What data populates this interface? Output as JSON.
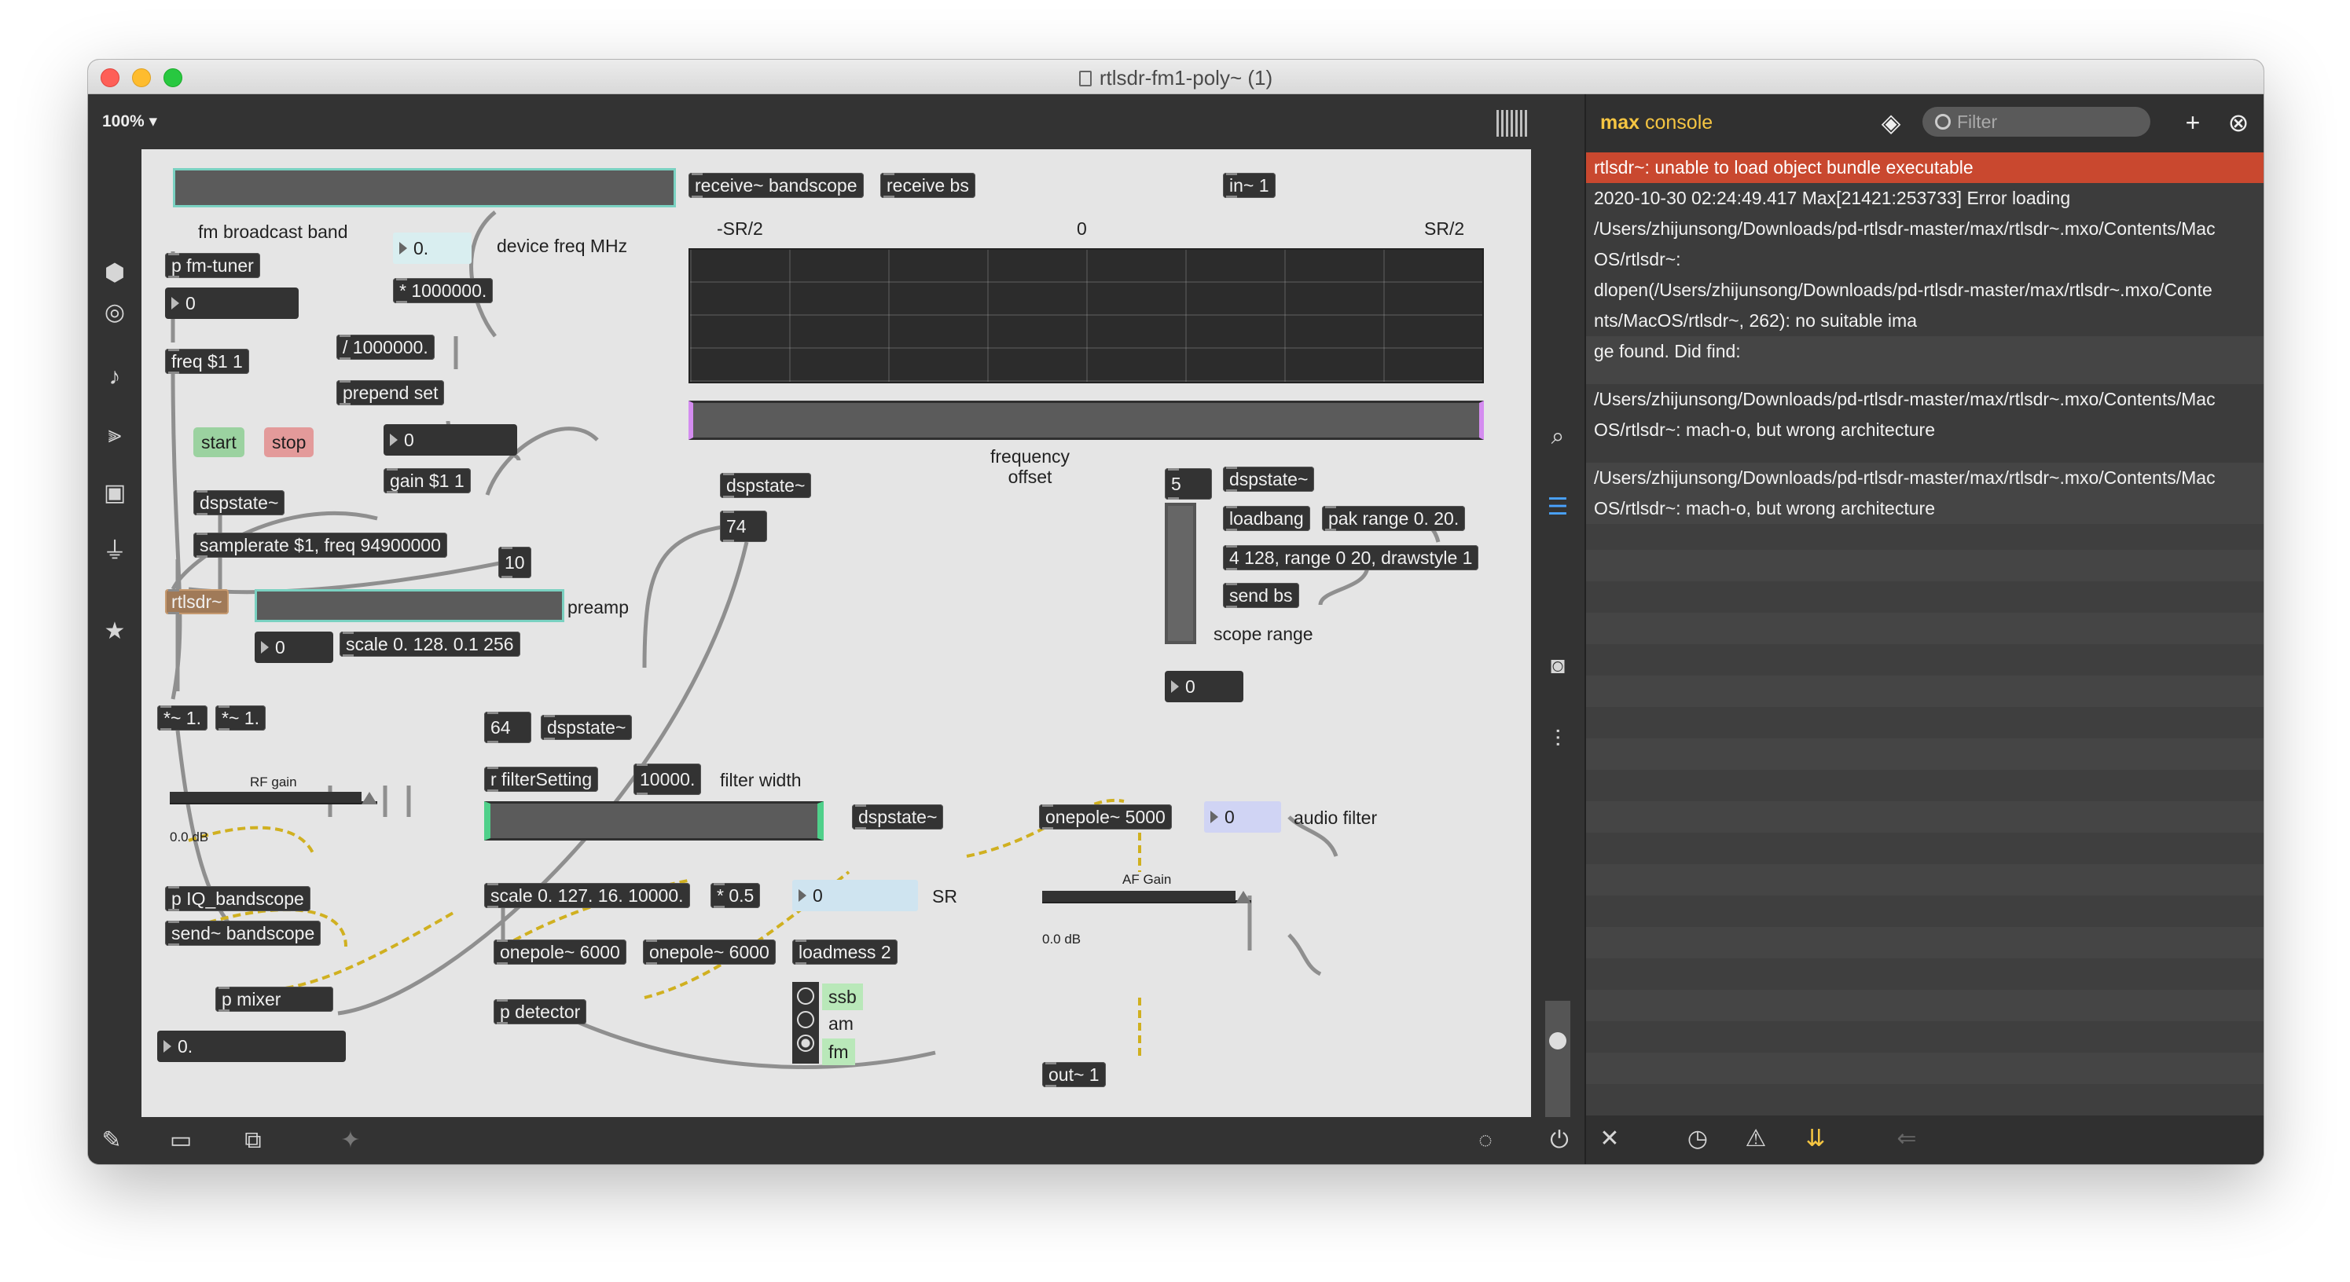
{
  "window": {
    "title": "rtlsdr-fm1-poly~ (1)"
  },
  "toolbar": {
    "zoom": "100%"
  },
  "patcher": {
    "labels": {
      "fm_broadcast_band": "fm broadcast band",
      "device_freq": "device freq MHz",
      "preamp": "preamp",
      "rf_gain": "RF gain",
      "rf_db": "0.0 dB",
      "sr2_left": "-SR/2",
      "zero": "0",
      "sr2_right": "SR/2",
      "freq_offset": "frequency\noffset",
      "scope_range": "scope range",
      "filter_width": "filter width",
      "sr": "SR",
      "audio_filter": "audio filter",
      "af_gain": "AF Gain",
      "af_db": "0.0 dB"
    },
    "objects": {
      "p_fm_tuner": "p fm-tuner",
      "num_0_a": "0",
      "freq_msg": "freq $1 1",
      "dev_freq": "0.",
      "mul_1e6": "* 1000000.",
      "div_1e6": "/ 1000000.",
      "prepend_set": "prepend set",
      "start": "start",
      "stop": "stop",
      "num_0_b": "0",
      "gain_msg": "gain $1 1",
      "dspstate_1": "dspstate~",
      "samplerate_msg": "samplerate $1, freq 94900000",
      "ten": "10",
      "rtlsdr": "rtlsdr~",
      "num_0_c": "0",
      "scale_1": "scale 0. 128. 0.1 256",
      "mul1_a": "*~ 1.",
      "mul1_b": "*~ 1.",
      "p_iq": "p IQ_bandscope",
      "send_bandscope": "send~ bandscope",
      "p_mixer": "p mixer",
      "num_out": "0.",
      "receive_bandscope": "receive~ bandscope",
      "receive_bs": "receive bs",
      "in1": "in~ 1",
      "dspstate_2": "dspstate~",
      "num_74": "74",
      "num_5": "5",
      "dspstate_3": "dspstate~",
      "loadbang": "loadbang",
      "pak_range": "pak range 0. 20.",
      "drawstyle_msg": "4 128, range 0 20, drawstyle 1",
      "send_bs": "send bs",
      "num_0_d": "0",
      "num_64": "64",
      "dspstate_4": "dspstate~",
      "r_filter": "r filterSetting",
      "filter_val": "10000.",
      "dspstate_5": "dspstate~",
      "scale_2": "scale 0. 127. 16. 10000.",
      "mul_05": "* 0.5",
      "sr_num": "0",
      "onepole_a": "onepole~ 6000",
      "onepole_b": "onepole~ 6000",
      "loadmess": "loadmess 2",
      "p_detector": "p detector",
      "mode_ssb": "ssb",
      "mode_am": "am",
      "mode_fm": "fm",
      "onepole_5000": "onepole~ 5000",
      "af_num": "0",
      "out1": "out~ 1"
    }
  },
  "console": {
    "title_bold": "max",
    "title_rest": " console",
    "filter_placeholder": "Filter",
    "rows": [
      "rtlsdr~: unable to load object bundle executable",
      " 2020-10-30 02:24:49.417 Max[21421:253733] Error loading",
      "/Users/zhijunsong/Downloads/pd-rtlsdr-master/max/rtlsdr~.mxo/Contents/Mac",
      "OS/rtlsdr~:",
      "dlopen(/Users/zhijunsong/Downloads/pd-rtlsdr-master/max/rtlsdr~.mxo/Conte",
      "nts/MacOS/rtlsdr~, 262): no suitable ima",
      " ge found.  Did find:",
      "",
      "/Users/zhijunsong/Downloads/pd-rtlsdr-master/max/rtlsdr~.mxo/Contents/Mac",
      "OS/rtlsdr~: mach-o, but wrong architecture",
      "",
      "/Users/zhijunsong/Downloads/pd-rtlsdr-master/max/rtlsdr~.mxo/Contents/Mac",
      "OS/rtlsdr~: mach-o, but wrong architecture"
    ]
  },
  "colors": {
    "accent": "#f5c542",
    "error_row": "#c9482f",
    "canvas": "#e5e5e5",
    "object": "#333333"
  }
}
